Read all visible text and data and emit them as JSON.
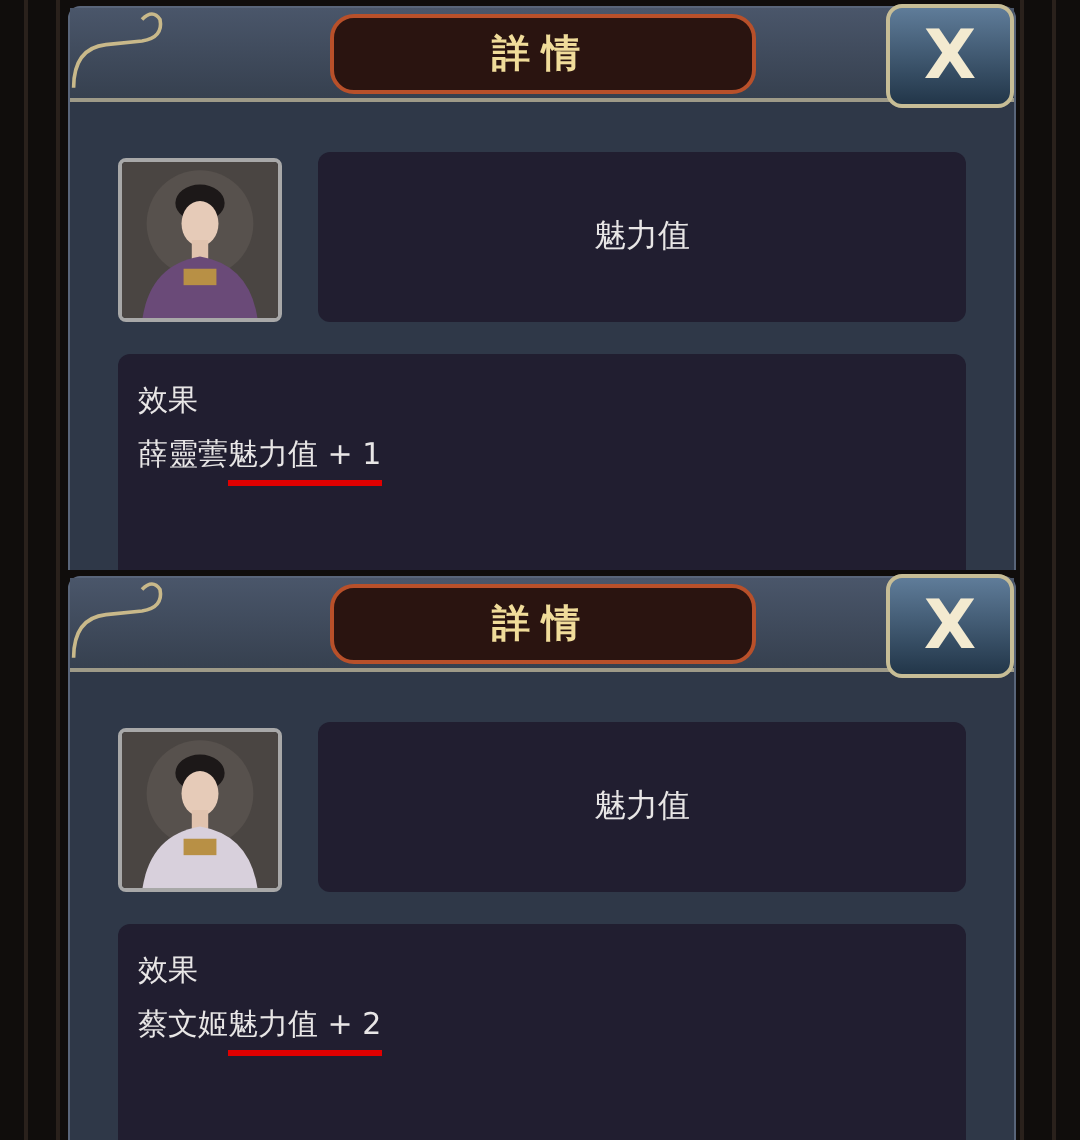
{
  "panels": [
    {
      "title": "詳情",
      "close": "X",
      "item_name": "魅力值",
      "effect_heading": "效果",
      "effect_subject": "薛靈蕓",
      "effect_highlight": "魅力值 + 1"
    },
    {
      "title": "詳情",
      "close": "X",
      "item_name": "魅力值",
      "effect_heading": "效果",
      "effect_subject": "蔡文姬",
      "effect_highlight": "魅力值 + 2"
    }
  ]
}
